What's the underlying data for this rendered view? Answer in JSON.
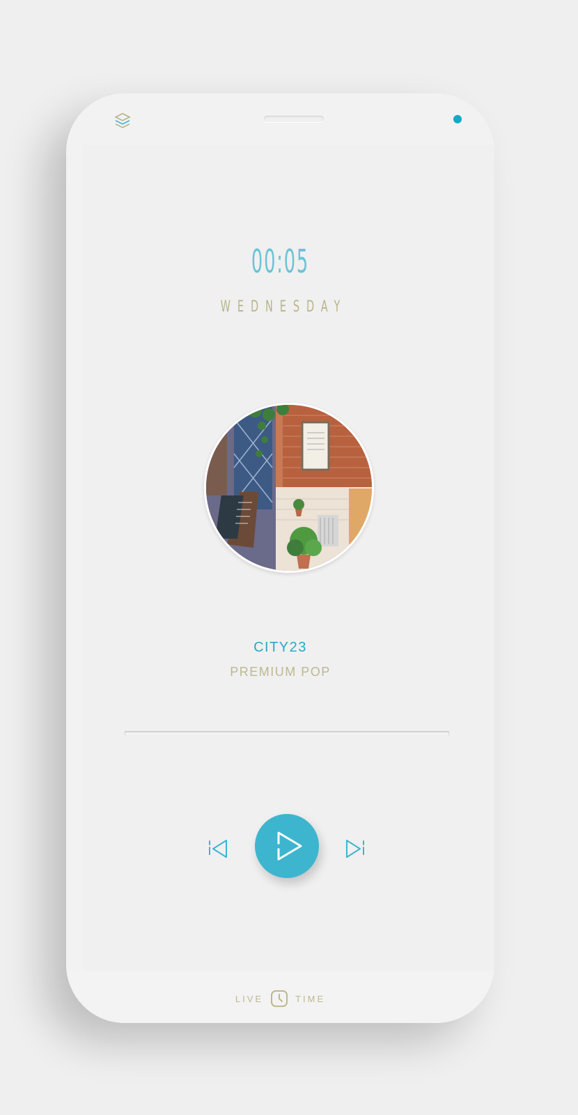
{
  "colors": {
    "accent": "#3db5ce",
    "accent_dark": "#14a9c8",
    "gold": "#b8b489",
    "clock": "#6cc3d6",
    "background": "#efefef"
  },
  "header": {
    "left_icon": "layers-icon",
    "status_indicator": "status-dot"
  },
  "clock": {
    "time": "00:05",
    "day": "WEDNESDAY"
  },
  "track": {
    "title": "CITY23",
    "genre": "PREMIUM POP",
    "progress": 0.0,
    "cover_icon": "album-cover"
  },
  "controls": {
    "prev_icon": "previous-track-icon",
    "play_icon": "play-icon",
    "next_icon": "next-track-icon"
  },
  "footer": {
    "left_label": "LIVE",
    "right_label": "TIME",
    "icon": "clock-icon"
  }
}
